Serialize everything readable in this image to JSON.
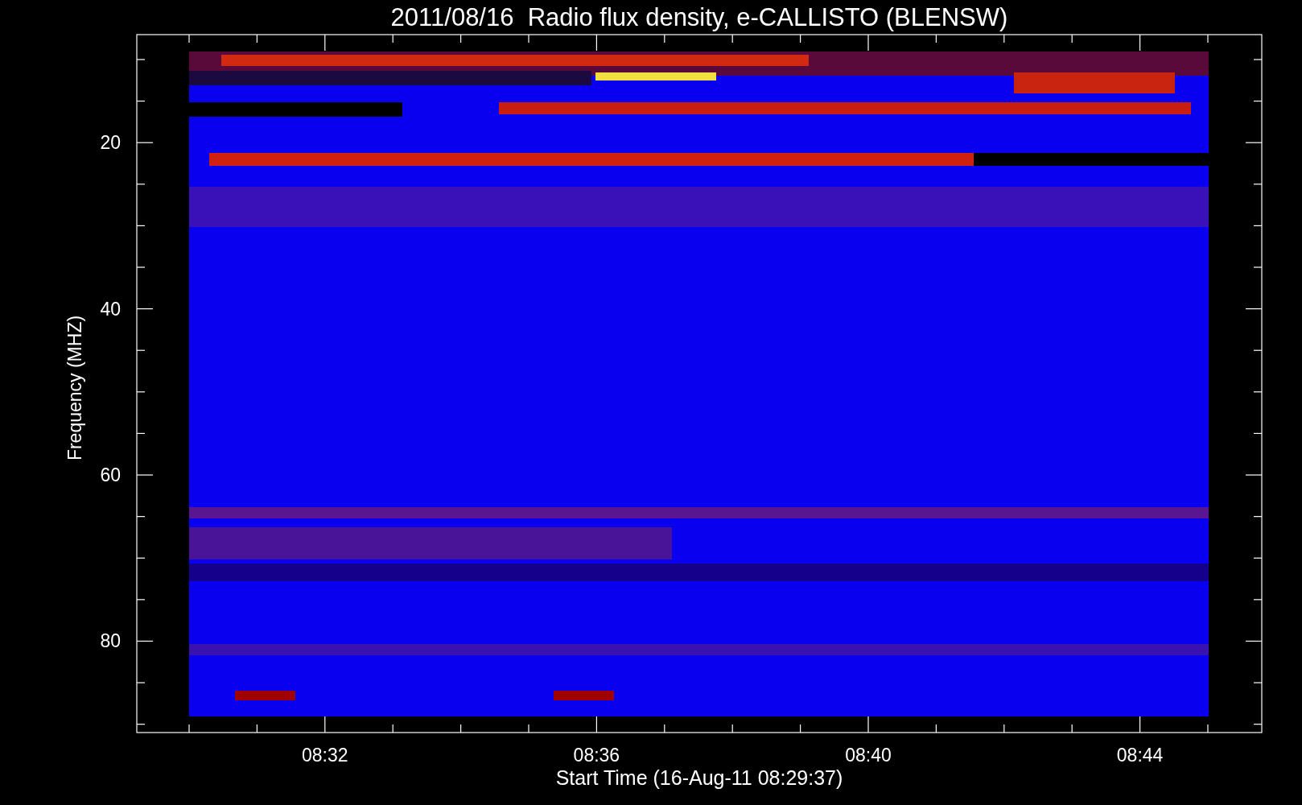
{
  "title": "2011/08/16  Radio flux density, e-CALLISTO (BLENSW)",
  "y_axis": {
    "label": "Frequency (MHZ)",
    "ticks": [
      "20",
      "40",
      "60",
      "80"
    ]
  },
  "x_axis": {
    "label": "Start Time (16-Aug-11 08:29:37)",
    "ticks": [
      "08:32",
      "08:36",
      "08:40",
      "08:44"
    ]
  }
}
